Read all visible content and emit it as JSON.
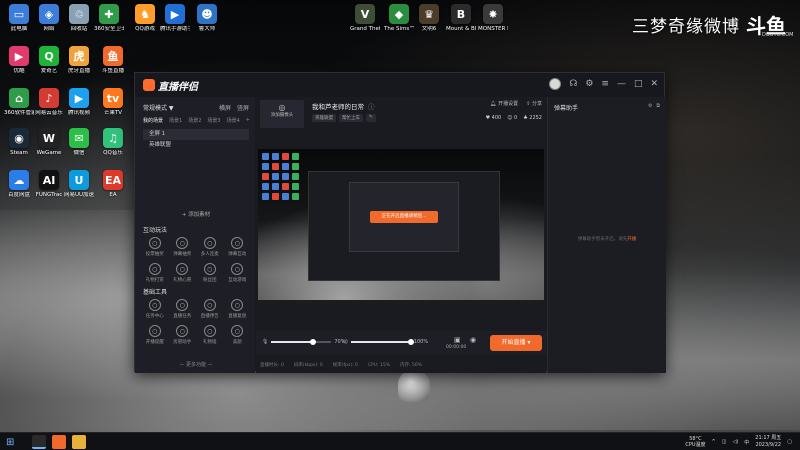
{
  "desktop": {
    "icons": [
      {
        "label": "此电脑",
        "icon": "computer-icon",
        "color": "#3b7dd8",
        "glyph": "▭"
      },
      {
        "label": "网络",
        "icon": "network-icon",
        "color": "#3b7dd8",
        "glyph": "◈"
      },
      {
        "label": "回收站",
        "icon": "recycle-bin-icon",
        "color": "#8aa0b5",
        "glyph": "♲"
      },
      {
        "label": "360安全卫士",
        "icon": "security-icon",
        "color": "#2f9c4a",
        "glyph": "✚"
      },
      {
        "label": "QQ游戏",
        "icon": "qq-game-icon",
        "color": "#ff9d2b",
        "glyph": "♞"
      },
      {
        "label": "腾讯手游助手",
        "icon": "mobile-game-icon",
        "color": "#1f6fd6",
        "glyph": "▶"
      },
      {
        "label": "鲁大师",
        "icon": "ludashi-icon",
        "color": "#2d74c9",
        "glyph": "☻"
      },
      {
        "label": "Grand Theft Auto V",
        "icon": "gta-icon",
        "color": "#3d4d36",
        "glyph": "V"
      },
      {
        "label": "The Sims™ 4",
        "icon": "sims-icon",
        "color": "#2b8d3e",
        "glyph": "◆"
      },
      {
        "label": "文明6",
        "icon": "civ-icon",
        "color": "#4b3d2a",
        "glyph": "♛"
      },
      {
        "label": "Mount & Blade II",
        "icon": "bannerlord-icon",
        "color": "#2b2b2b",
        "glyph": "B"
      },
      {
        "label": "MONSTER HUNTER",
        "icon": "monster-hunter-icon",
        "color": "#3a3a3a",
        "glyph": "✸"
      },
      {
        "label": "优酷",
        "icon": "youku-icon",
        "color": "#e23a6d",
        "glyph": "▶"
      },
      {
        "label": "爱奇艺",
        "icon": "iqiyi-icon",
        "color": "#1fb33a",
        "glyph": "Q"
      },
      {
        "label": "虎牙直播",
        "icon": "huya-icon",
        "color": "#f2a23a",
        "glyph": "虎"
      },
      {
        "label": "斗鱼直播",
        "icon": "douyu-icon",
        "color": "#f26a2b",
        "glyph": "鱼"
      },
      {
        "label": "360软件管家",
        "icon": "software-manager-icon",
        "color": "#2f9c4a",
        "glyph": "⌂"
      },
      {
        "label": "网易云音乐",
        "icon": "music-icon",
        "color": "#d43c33",
        "glyph": "♪"
      },
      {
        "label": "腾讯视频",
        "icon": "tencent-video-icon",
        "color": "#1ea0f0",
        "glyph": "▶"
      },
      {
        "label": "芒果TV",
        "icon": "mango-tv-icon",
        "color": "#ff7a1f",
        "glyph": "tv"
      },
      {
        "label": "Steam",
        "icon": "steam-icon",
        "color": "#1b2838",
        "glyph": "◉"
      },
      {
        "label": "WeGame",
        "icon": "wegame-icon",
        "color": "#222",
        "glyph": "W"
      },
      {
        "label": "微信",
        "icon": "wechat-icon",
        "color": "#2bbf4a",
        "glyph": "✉"
      },
      {
        "label": "QQ音乐",
        "icon": "qq-music-icon",
        "color": "#31c27c",
        "glyph": "♫"
      },
      {
        "label": "百度网盘",
        "icon": "baidu-pan-icon",
        "color": "#2b7de9",
        "glyph": "☁"
      },
      {
        "label": "FUNGTrac",
        "icon": "ai-icon",
        "color": "#111",
        "glyph": "AI"
      },
      {
        "label": "网易UU加速器",
        "icon": "uu-icon",
        "color": "#0d9be0",
        "glyph": "U"
      },
      {
        "label": "EA",
        "icon": "ea-icon",
        "color": "#e03a2b",
        "glyph": "EA"
      }
    ],
    "watermark": {
      "text": "三梦奇缘微博",
      "logo": "斗鱼",
      "sub": "DOUYU.COM"
    }
  },
  "app": {
    "name": "直播伴侣",
    "mode": "常规模式 ▼",
    "mode_tabs": [
      "横屏",
      "竖屏"
    ],
    "scene_tabs": [
      "我的场景",
      "场景1",
      "场景2",
      "场景3",
      "场景4"
    ],
    "scenes": [
      "全屏 1",
      "英雄联盟"
    ],
    "add_material": "+ 添加素材",
    "interaction_title": "互动玩法",
    "interaction_tools": [
      {
        "label": "投票抽奖",
        "icon": "vote-icon"
      },
      {
        "label": "弹幕抽奖",
        "icon": "danmu-lottery-icon"
      },
      {
        "label": "多人连麦",
        "icon": "multi-mic-icon"
      },
      {
        "label": "弹幕互动",
        "icon": "danmu-icon"
      },
      {
        "label": "礼物打赏",
        "icon": "gift-icon"
      },
      {
        "label": "礼物心愿",
        "icon": "wish-icon"
      },
      {
        "label": "粉丝团",
        "icon": "fans-icon"
      },
      {
        "label": "互动游戏",
        "icon": "game-icon"
      }
    ],
    "basic_title": "基础工具",
    "basic_tools": [
      {
        "label": "任务中心",
        "icon": "task-icon"
      },
      {
        "label": "直播任务",
        "icon": "live-task-icon"
      },
      {
        "label": "直播预告",
        "icon": "notice-icon"
      },
      {
        "label": "直播复盘",
        "icon": "review-icon"
      },
      {
        "label": "开播提醒",
        "icon": "calendar-icon"
      },
      {
        "label": "房管助手",
        "icon": "home-icon"
      },
      {
        "label": "礼物墙",
        "icon": "gift-wall-icon"
      },
      {
        "label": "美颜",
        "icon": "beauty-icon"
      }
    ],
    "more_functions": "— 更多功能 —",
    "add_screen": "添加摄像头",
    "live_title": "我和芦老师的日常",
    "live_tags": [
      "英雄联盟",
      "帮忙上车"
    ],
    "live_actions": [
      "开播设置",
      "分享"
    ],
    "live_stats": [
      "400",
      "0",
      "2252"
    ],
    "nested_notice": "正在开启直播请稍后...",
    "volume_mic": "70%",
    "volume_speaker": "100%",
    "volume_mic_level": 0.7,
    "volume_speaker_level": 1.0,
    "timer": "00:00:00",
    "start_button": "开始直播 ▾",
    "status": [
      "直播时长: 0",
      "码率(kbps): 0",
      "帧率(fps): 0",
      "CPU: 15%",
      "内存: 50%"
    ],
    "danmu_title": "弹幕助手",
    "danmu_empty": "弹幕助手暂未开启，请先",
    "danmu_link": "开播"
  },
  "taskbar": {
    "weather": "58°C\nCPU温度",
    "time": "21:17 周五",
    "date": "2023/9/22"
  },
  "colors": {
    "accent": "#f26a2b",
    "panel": "#1e1f26"
  }
}
